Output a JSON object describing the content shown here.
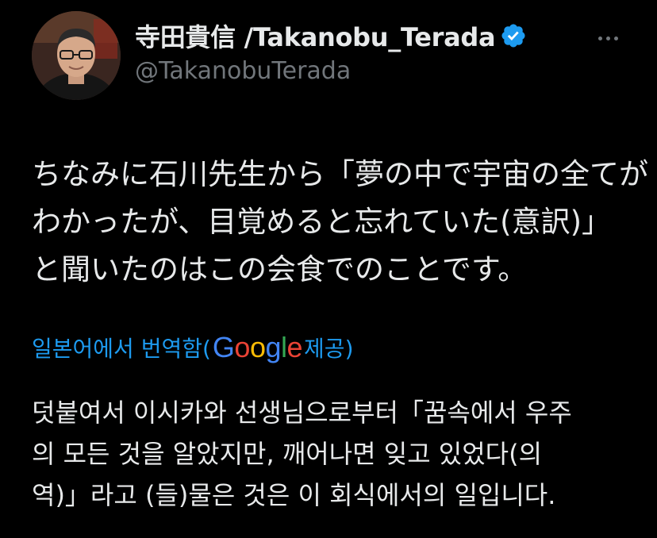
{
  "author": {
    "display_name": "寺田貴信 /Takanobu_Terada",
    "handle": "@TakanobuTerada",
    "verified": true,
    "avatar_icon": "profile-photo"
  },
  "menu": {
    "more_icon": "ellipsis-icon"
  },
  "tweet": {
    "lines": [
      "ちなみに石川先生から「夢の中で宇宙の全てが",
      "わかったが、目覚めると忘れていた(意訳)」",
      "と聞いたのはこの会食でのことです。"
    ]
  },
  "translation": {
    "prefix": "일본어에서 번역함(",
    "provider_letters": [
      "G",
      "o",
      "o",
      "g",
      "l",
      "e"
    ],
    "suffix": " 제공)",
    "lines": [
      "덧붙여서 이시카와 선생님으로부터「꿈속에서 우주",
      "의 모든 것을 알았지만, 깨어나면 잊고 있었다(의",
      "역)」라고 (들)물은 것은 이 회식에서의 일입니다."
    ]
  },
  "colors": {
    "background": "#000000",
    "text": "#e7e9ea",
    "secondary": "#71767b",
    "link": "#1d9bf0",
    "verified": "#1d9bf0"
  }
}
